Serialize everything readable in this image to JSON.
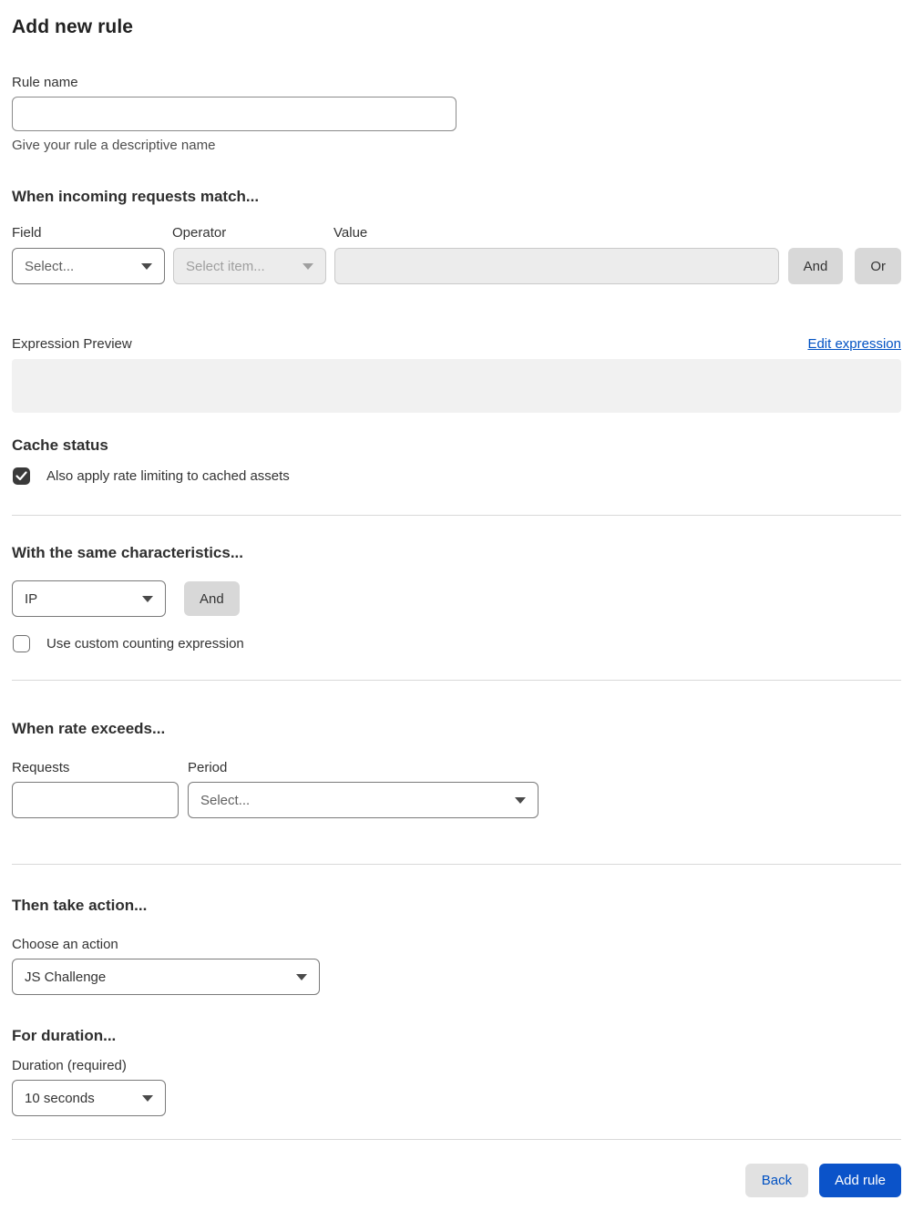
{
  "page": {
    "title": "Add new rule"
  },
  "rule_name": {
    "label": "Rule name",
    "value": "",
    "help": "Give your rule a descriptive name"
  },
  "match": {
    "heading": "When incoming requests match...",
    "field": {
      "label": "Field",
      "selected": "Select..."
    },
    "operator": {
      "label": "Operator",
      "selected": "Select item...",
      "disabled": true
    },
    "value": {
      "label": "Value",
      "value": "",
      "disabled": true
    },
    "and_label": "And",
    "or_label": "Or"
  },
  "expression": {
    "label": "Expression Preview",
    "edit_link": "Edit expression",
    "content": ""
  },
  "cache": {
    "heading": "Cache status",
    "option": "Also apply rate limiting to cached assets",
    "checked": true
  },
  "characteristics": {
    "heading": "With the same characteristics...",
    "selected": "IP",
    "and_label": "And",
    "option": "Use custom counting expression",
    "checked": false
  },
  "rate": {
    "heading": "When rate exceeds...",
    "requests": {
      "label": "Requests",
      "value": ""
    },
    "period": {
      "label": "Period",
      "selected": "Select..."
    }
  },
  "action": {
    "heading": "Then take action...",
    "label": "Choose an action",
    "selected": "JS Challenge"
  },
  "duration": {
    "heading": "For duration...",
    "label": "Duration (required)",
    "selected": "10 seconds"
  },
  "footer": {
    "back_label": "Back",
    "submit_label": "Add rule"
  },
  "colors": {
    "accent_blue": "#0051c3",
    "primary_button": "#0b53c9",
    "disabled_bg": "#ececec",
    "divider": "#d9d9d9",
    "checkbox_checked": "#3a3a3a"
  }
}
